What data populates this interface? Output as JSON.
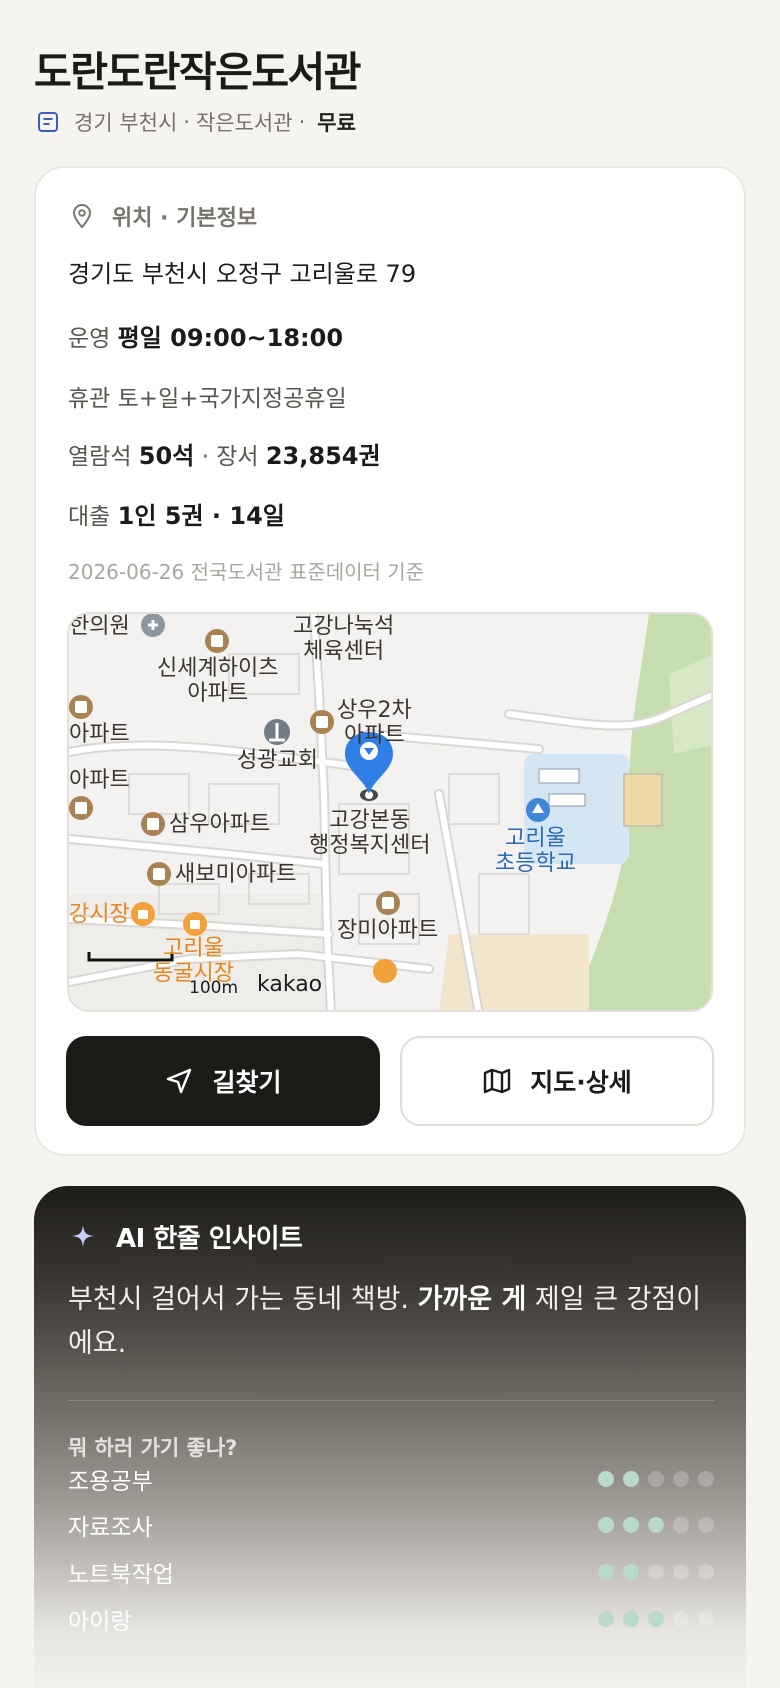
{
  "header": {
    "title": "도란도란작은도서관",
    "region": "경기 부천시",
    "category": "작은도서관",
    "separator": "·",
    "fee": "무료"
  },
  "info": {
    "section_title": "위치 · 기본정보",
    "address": "경기도 부천시 오정구 고리울로 79",
    "hours_label": "운영",
    "hours_value": "평일 09:00~18:00",
    "closed_label": "휴관",
    "closed_value": "토+일+국가지정공휴일",
    "seats_label": "열람석",
    "seats_value": "50석",
    "books_sep": "· 장서",
    "books_value": "23,854권",
    "loan_label": "대출",
    "loan_value": "1인 5권 · 14일",
    "data_ref": "2026-06-26 전국도서관 표준데이터 기준"
  },
  "map": {
    "labels": {
      "clinic": "한의원",
      "gym": "고강나눅석\n체육센터",
      "apt_shinsegae": "신세계하이츠\n아파트",
      "apt_sangwoo2": "상우2차\n아파트",
      "apt_left1": "아파트",
      "apt_left2": "아파트",
      "church": "성광교회",
      "office": "고강본동\n행정복지센터",
      "school": "고리울\n초등학교",
      "apt_samwoo": "삼우아파트",
      "apt_saebom": "새보미아파트",
      "market_left": "강시장",
      "market_goriul": "고리울\n동굴시장",
      "apt_jangmi": "장미아파트",
      "scale": "100m",
      "brand": "kakao"
    }
  },
  "actions": {
    "directions": "길찾기",
    "map_detail": "지도·상세"
  },
  "ai": {
    "title": "AI 한줄 인사이트",
    "text_pre": "부천시 걸어서 가는 동네 책방. ",
    "text_bold": "가까운 게",
    "text_post": " 제일 큰 강점이에요.",
    "question": "뭐 하러 가기 좋나?",
    "activities": [
      {
        "label": "조용공부",
        "level": 2,
        "max": 5
      },
      {
        "label": "자료조사",
        "level": 3,
        "max": 5
      },
      {
        "label": "노트북작업",
        "level": 2,
        "max": 5
      },
      {
        "label": "아이랑",
        "level": 3,
        "max": 5
      }
    ]
  },
  "colors": {
    "accent_marker": "#2f7fe6",
    "dot_on": "#b9dacb",
    "primary_button": "#1d1b18"
  }
}
